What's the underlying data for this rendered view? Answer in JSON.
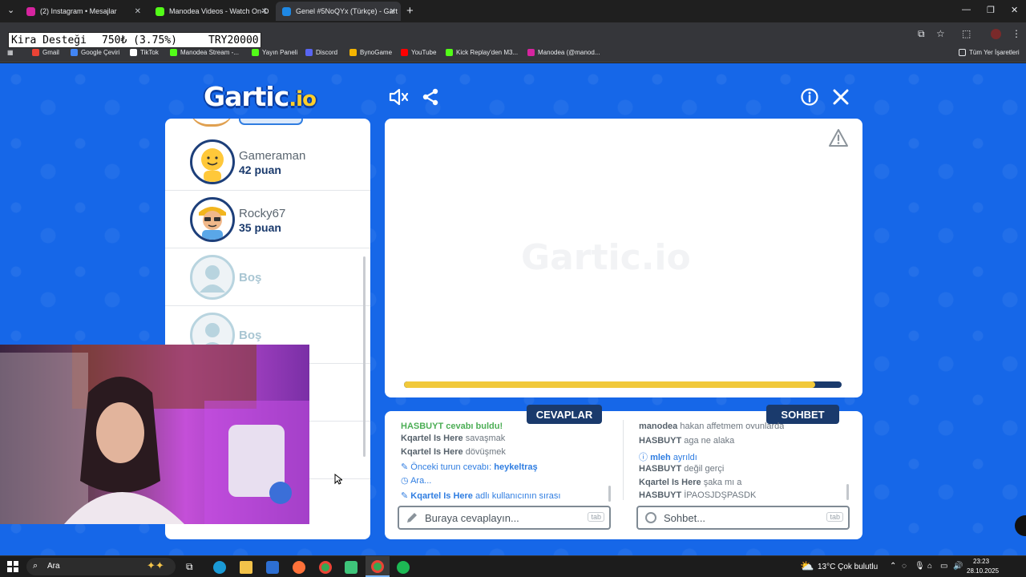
{
  "browser": {
    "tabs": [
      {
        "title": "(2) Instagram • Mesajlar",
        "color": "#d6249f"
      },
      {
        "title": "Manodea Videos - Watch On-D",
        "color": "#53fc18"
      },
      {
        "title": "Genel #5NoQYx (Türkçe) - Gart",
        "color": "#1e88e5"
      }
    ],
    "bookmarks": [
      {
        "label": "Gmail",
        "color": "#ea4335"
      },
      {
        "label": "Google Çeviri",
        "color": "#4285f4"
      },
      {
        "label": "TikTok",
        "color": "#ffffff"
      },
      {
        "label": "Manodea Stream -...",
        "color": "#53fc18"
      },
      {
        "label": "Yayın Paneli",
        "color": "#53fc18"
      },
      {
        "label": "Discord",
        "color": "#5865f2"
      },
      {
        "label": "BynoGame",
        "color": "#f4b400"
      },
      {
        "label": "YouTube",
        "color": "#ff0000"
      },
      {
        "label": "Kick Replay'den M3...",
        "color": "#53fc18"
      },
      {
        "label": "Manodea (@manod...",
        "color": "#d6249f"
      }
    ],
    "all_bookmarks": "Tüm Yer İşaretleri"
  },
  "donation": {
    "label": "Kira Desteği",
    "amount": "750₺ (3.75%)",
    "goal": "TRY20000",
    "progress_percent": 3.75
  },
  "game": {
    "logo_main": "Gartic",
    "logo_suffix": ".io",
    "canvas_watermark": "Gartic.io",
    "round_progress": 0.94,
    "players": [
      {
        "name": "Gameraman",
        "score": "42 puan"
      },
      {
        "name": "Rocky67",
        "score": "35 puan"
      },
      {
        "name": "Boş",
        "score": ""
      },
      {
        "name": "Boş",
        "score": ""
      }
    ],
    "answers_title": "CEVAPLAR",
    "chat_title": "SOHBET",
    "answers": {
      "partial_top": "HASBUYT cevabı buldu!",
      "line1_user": "Kqartel Is Here",
      "line1_text": "savaşmak",
      "line2_user": "Kqartel Is Here",
      "line2_text": "dövüşmek",
      "prev_answer_label": "Önceki turun cevabı:",
      "prev_answer_value": "heykeltraş",
      "pause": "Ara...",
      "turn_user": "Kqartel Is Here",
      "turn_text": "adlı kullanıcının sırası",
      "placeholder": "Buraya cevaplayın...",
      "tab_hint": "tab"
    },
    "chat": {
      "partial_top_user": "manodea",
      "partial_top_text": "hakan affetmem oyunlarda",
      "line1_user": "HASBUYT",
      "line1_text": "aga ne alaka",
      "leave_user": "mleh",
      "leave_text": "ayrıldı",
      "line2_user": "HASBUYT",
      "line2_text": "değil gerçi",
      "line3_user": "Kqartel Is Here",
      "line3_text": "şaka mı a",
      "line4_user": "HASBUYT",
      "line4_text": "İPAOSJDŞPASDK",
      "placeholder": "Sohbet...",
      "tab_hint": "tab"
    }
  },
  "taskbar": {
    "search_placeholder": "Ara",
    "weather": "13°C  Çok bulutlu",
    "time": "23:23",
    "date": "28.10.2025"
  }
}
